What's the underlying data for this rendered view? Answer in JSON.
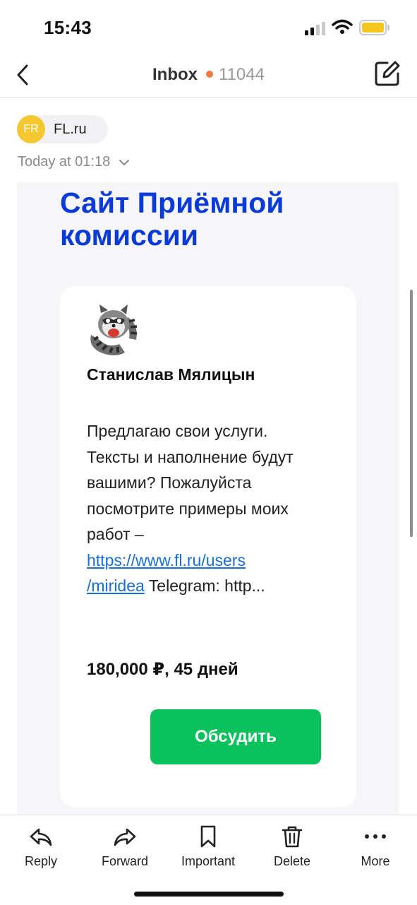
{
  "status_bar": {
    "time": "15:43"
  },
  "nav": {
    "title": "Inbox",
    "unread_count": "11044",
    "accent_color": "#f07a45"
  },
  "sender": {
    "initials": "FR",
    "name": "FL.ru",
    "date": "Today at 01:18"
  },
  "email": {
    "headline": "Сайт Приёмной комиссии",
    "author": "Станислав Мялицын",
    "description_text": "Предлагаю свои услуги. Тексты и наполнение будут вашими? Пожалуйста посмотрите примеры моих работ –",
    "link_line1": "https://www.fl.ru/users",
    "link_line2": "/miridea",
    "description_tail": "Telegram: http...",
    "price": "180,000 ₽, 45 дней",
    "button_label": "Обсудить",
    "button_color": "#0ac25c",
    "headline_color": "#0a3bd8"
  },
  "toolbar": {
    "reply": "Reply",
    "forward": "Forward",
    "important": "Important",
    "delete": "Delete",
    "more": "More"
  },
  "icons": [
    "back-icon",
    "compose-icon",
    "reply-icon",
    "forward-icon",
    "bookmark-icon",
    "trash-icon",
    "more-icon",
    "signal-icon",
    "wifi-icon",
    "battery-icon"
  ]
}
